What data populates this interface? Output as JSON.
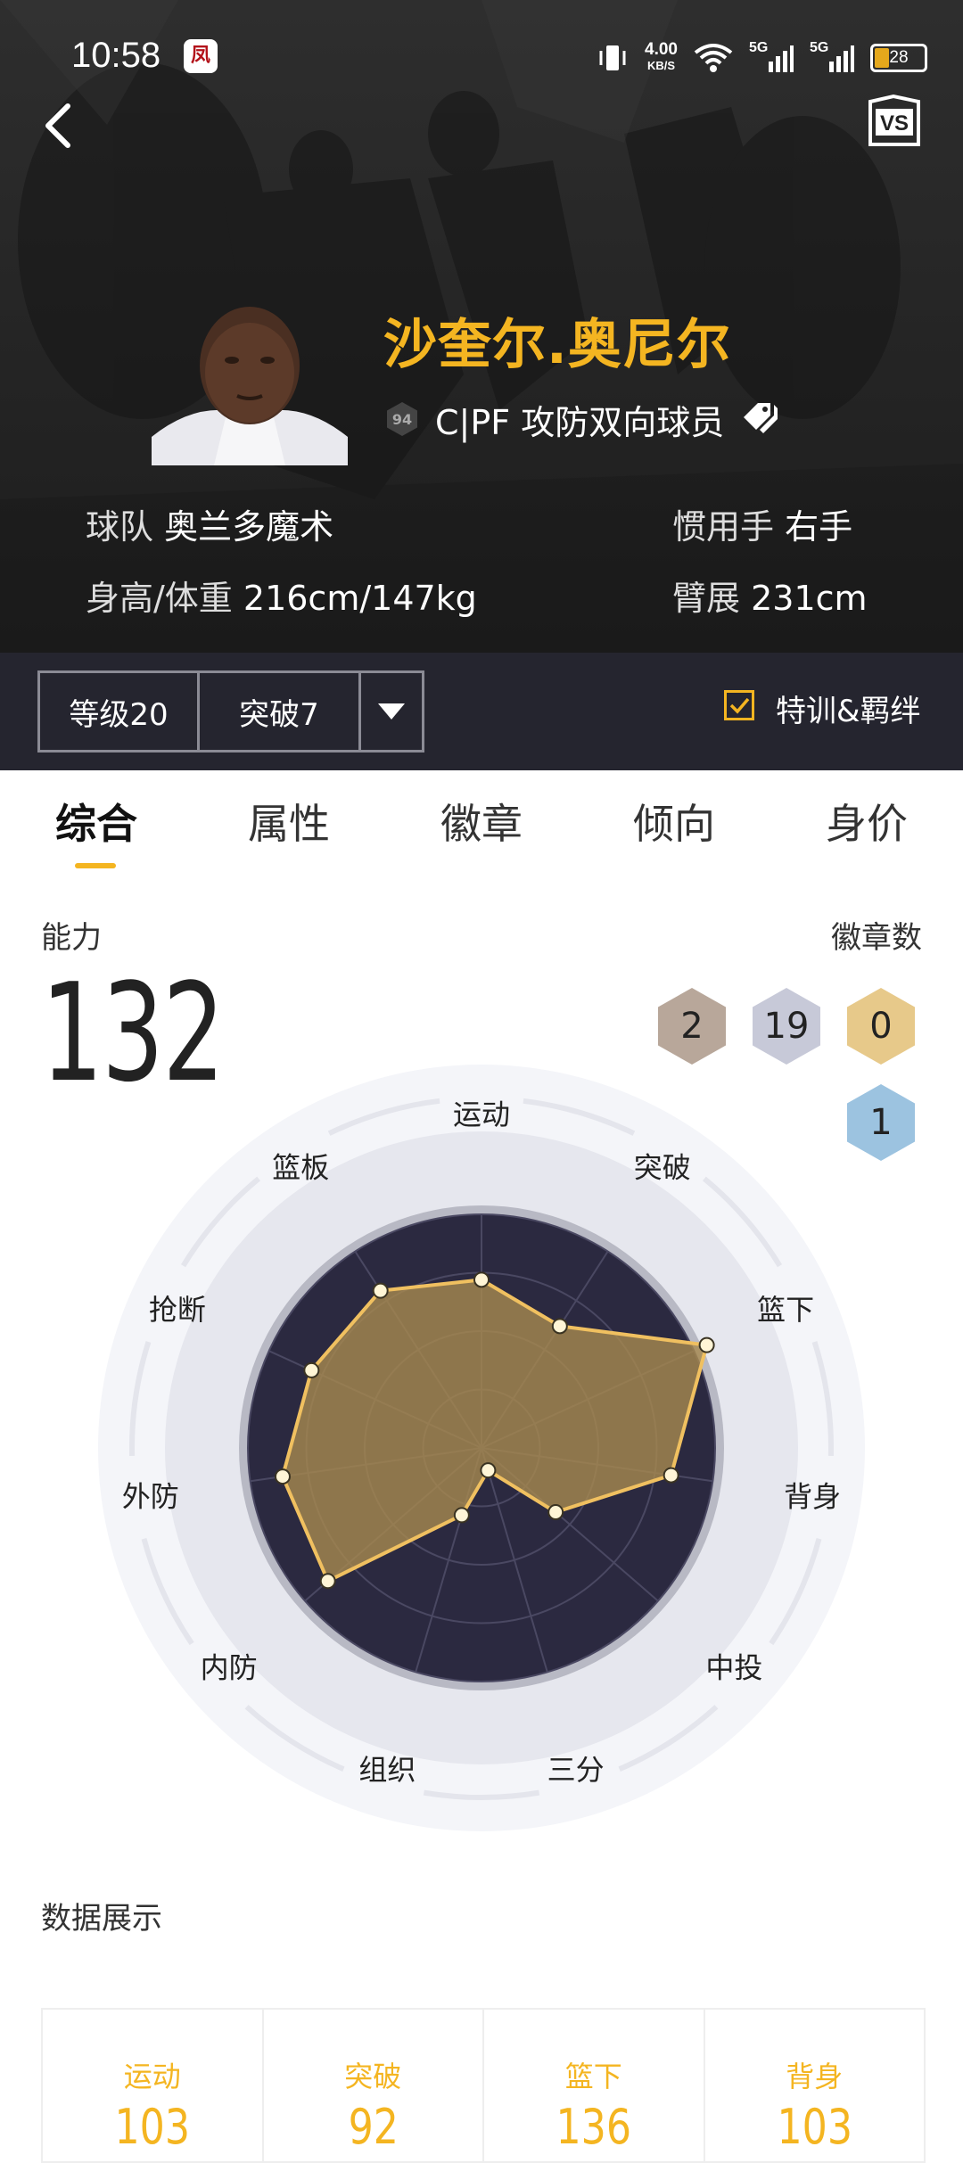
{
  "status_bar": {
    "time": "10:58",
    "app_icon": "凤",
    "net_speed_value": "4.00",
    "net_speed_unit": "KB/S",
    "sim1": "5G",
    "sim2": "5G",
    "battery": "28"
  },
  "header": {
    "player_name": "沙奎尔.奥尼尔",
    "ovr": "94",
    "position_role": "C|PF 攻防双向球员",
    "team_label": "球队",
    "team_value": "奥兰多魔术",
    "hand_label": "惯用手",
    "hand_value": "右手",
    "body_label": "身高/体重",
    "body_value": "216cm/147kg",
    "wingspan_label": "臂展",
    "wingspan_value": "231cm"
  },
  "controls": {
    "level": "等级20",
    "breakthrough": "突破7",
    "special_label": "特训&羁绊",
    "special_checked": true
  },
  "tabs": [
    "综合",
    "属性",
    "徽章",
    "倾向",
    "身价"
  ],
  "overview": {
    "ability_label": "能力",
    "ability_value": "132",
    "badge_count_label": "徽章数",
    "badges": [
      {
        "count": "2",
        "tier": "bronze",
        "color": "#b8a79a"
      },
      {
        "count": "19",
        "tier": "silver",
        "color": "#c7c9d8"
      },
      {
        "count": "0",
        "tier": "gold",
        "color": "#e7c98a"
      },
      {
        "count": "1",
        "tier": "hall-of-fame",
        "color": "#9cc3e0"
      }
    ]
  },
  "radar": {
    "labels": [
      "运动",
      "突破",
      "篮下",
      "背身",
      "中投",
      "三分",
      "组织",
      "内防",
      "外防",
      "抢断",
      "篮板"
    ],
    "values": [
      0.72,
      0.62,
      1.06,
      0.82,
      0.42,
      0.1,
      0.3,
      0.87,
      0.86,
      0.8,
      0.8
    ],
    "fill_color": "#a8894f",
    "line_color": "#f0c060"
  },
  "data_display": {
    "title": "数据展示",
    "stats": [
      {
        "name": "运动",
        "value": "103"
      },
      {
        "name": "突破",
        "value": "92"
      },
      {
        "name": "篮下",
        "value": "136"
      },
      {
        "name": "背身",
        "value": "103"
      }
    ]
  }
}
